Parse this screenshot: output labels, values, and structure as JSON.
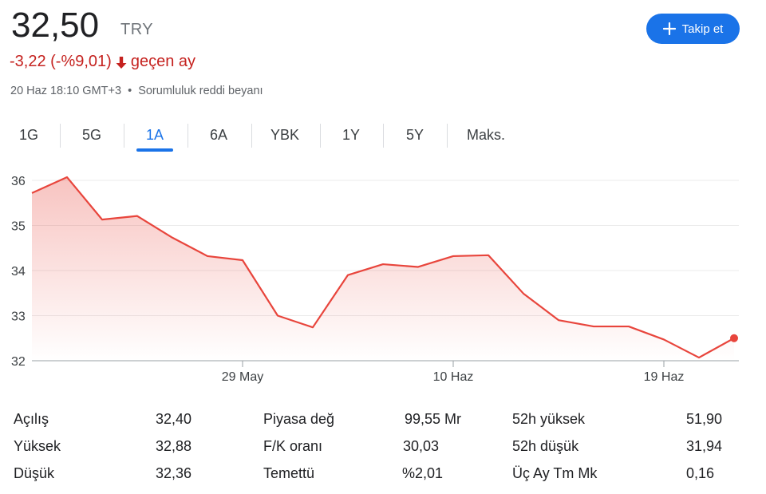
{
  "quote": {
    "price": "32,50",
    "currency": "TRY",
    "change": "-3,22 (-%9,01)",
    "change_period": "geçen ay",
    "change_color": "#c5221f",
    "timestamp": "20 Haz 18:10 GMT+3",
    "separator": "•",
    "disclaimer": "Sorumluluk reddi beyanı"
  },
  "follow_button": {
    "label": "Takip et",
    "icon": "plus-icon",
    "color": "#1a73e8"
  },
  "tabs": [
    {
      "label": "1G",
      "active": false
    },
    {
      "label": "5G",
      "active": false
    },
    {
      "label": "1A",
      "active": true
    },
    {
      "label": "6A",
      "active": false
    },
    {
      "label": "YBK",
      "active": false
    },
    {
      "label": "1Y",
      "active": false
    },
    {
      "label": "5Y",
      "active": false
    },
    {
      "label": "Maks.",
      "active": false
    }
  ],
  "chart_data": {
    "type": "area",
    "line_color": "#e8453c",
    "ylim": [
      32,
      36
    ],
    "y_ticks": [
      "32",
      "33",
      "34",
      "35",
      "36"
    ],
    "x_ticks": [
      {
        "label": "29 May",
        "index": 6
      },
      {
        "label": "10 Haz",
        "index": 12
      },
      {
        "label": "19 Haz",
        "index": 18
      }
    ],
    "values": [
      35.72,
      36.07,
      35.13,
      35.21,
      34.73,
      34.32,
      34.23,
      33.0,
      32.74,
      33.9,
      34.14,
      34.08,
      34.32,
      34.34,
      33.49,
      32.9,
      32.76,
      32.76,
      32.47,
      32.07,
      32.5
    ]
  },
  "stats": {
    "rows": [
      [
        {
          "label": "Açılış",
          "value": "32,40"
        },
        {
          "label": "Piyasa değ",
          "value": "99,55 Mr"
        },
        {
          "label": "52h yüksek",
          "value": "51,90"
        }
      ],
      [
        {
          "label": "Yüksek",
          "value": "32,88"
        },
        {
          "label": "F/K oranı",
          "value": "30,03"
        },
        {
          "label": "52h düşük",
          "value": "31,94"
        }
      ],
      [
        {
          "label": "Düşük",
          "value": "32,36"
        },
        {
          "label": "Temettü",
          "value": "%2,01"
        },
        {
          "label": "Üç Ay Tm Mk",
          "value": "0,16"
        }
      ]
    ]
  }
}
